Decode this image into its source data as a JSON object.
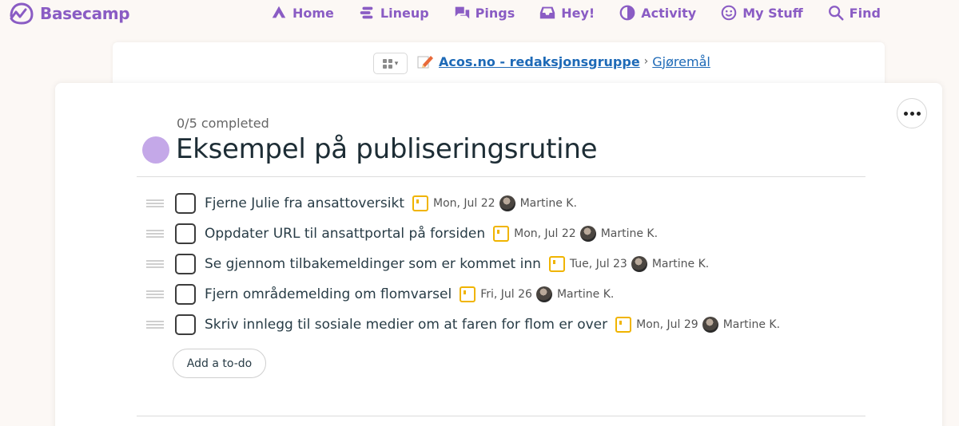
{
  "app": {
    "name": "Basecamp",
    "brand_color": "#8a5cc4"
  },
  "nav": [
    {
      "label": "Home",
      "icon": "home-icon"
    },
    {
      "label": "Lineup",
      "icon": "lineup-icon"
    },
    {
      "label": "Pings",
      "icon": "pings-icon"
    },
    {
      "label": "Hey!",
      "icon": "inbox-icon"
    },
    {
      "label": "Activity",
      "icon": "activity-icon"
    },
    {
      "label": "My Stuff",
      "icon": "smiley-icon"
    },
    {
      "label": "Find",
      "icon": "search-icon"
    }
  ],
  "breadcrumb": {
    "project": "Acos.no - redaksjonsgruppe",
    "separator": "›",
    "current": "Gjøremål"
  },
  "list": {
    "progress": "0/5 completed",
    "title": "Eksempel på publiseringsrutine",
    "dot_color": "#c4a8e8",
    "add_label": "Add a to-do",
    "todos": [
      {
        "text": "Fjerne Julie fra ansattoversikt",
        "date": "Mon, Jul 22",
        "assignee": "Martine K.",
        "done": false
      },
      {
        "text": "Oppdater URL til ansattportal på forsiden",
        "date": "Mon, Jul 22",
        "assignee": "Martine K.",
        "done": false
      },
      {
        "text": "Se gjennom tilbakemeldinger som er kommet inn",
        "date": "Tue, Jul 23",
        "assignee": "Martine K.",
        "done": false
      },
      {
        "text": "Fjern områdemelding om flomvarsel",
        "date": "Fri, Jul 26",
        "assignee": "Martine K.",
        "done": false
      },
      {
        "text": "Skriv innlegg til sosiale medier om at faren for flom er over",
        "date": "Mon, Jul 29",
        "assignee": "Martine K.",
        "done": false
      }
    ]
  }
}
